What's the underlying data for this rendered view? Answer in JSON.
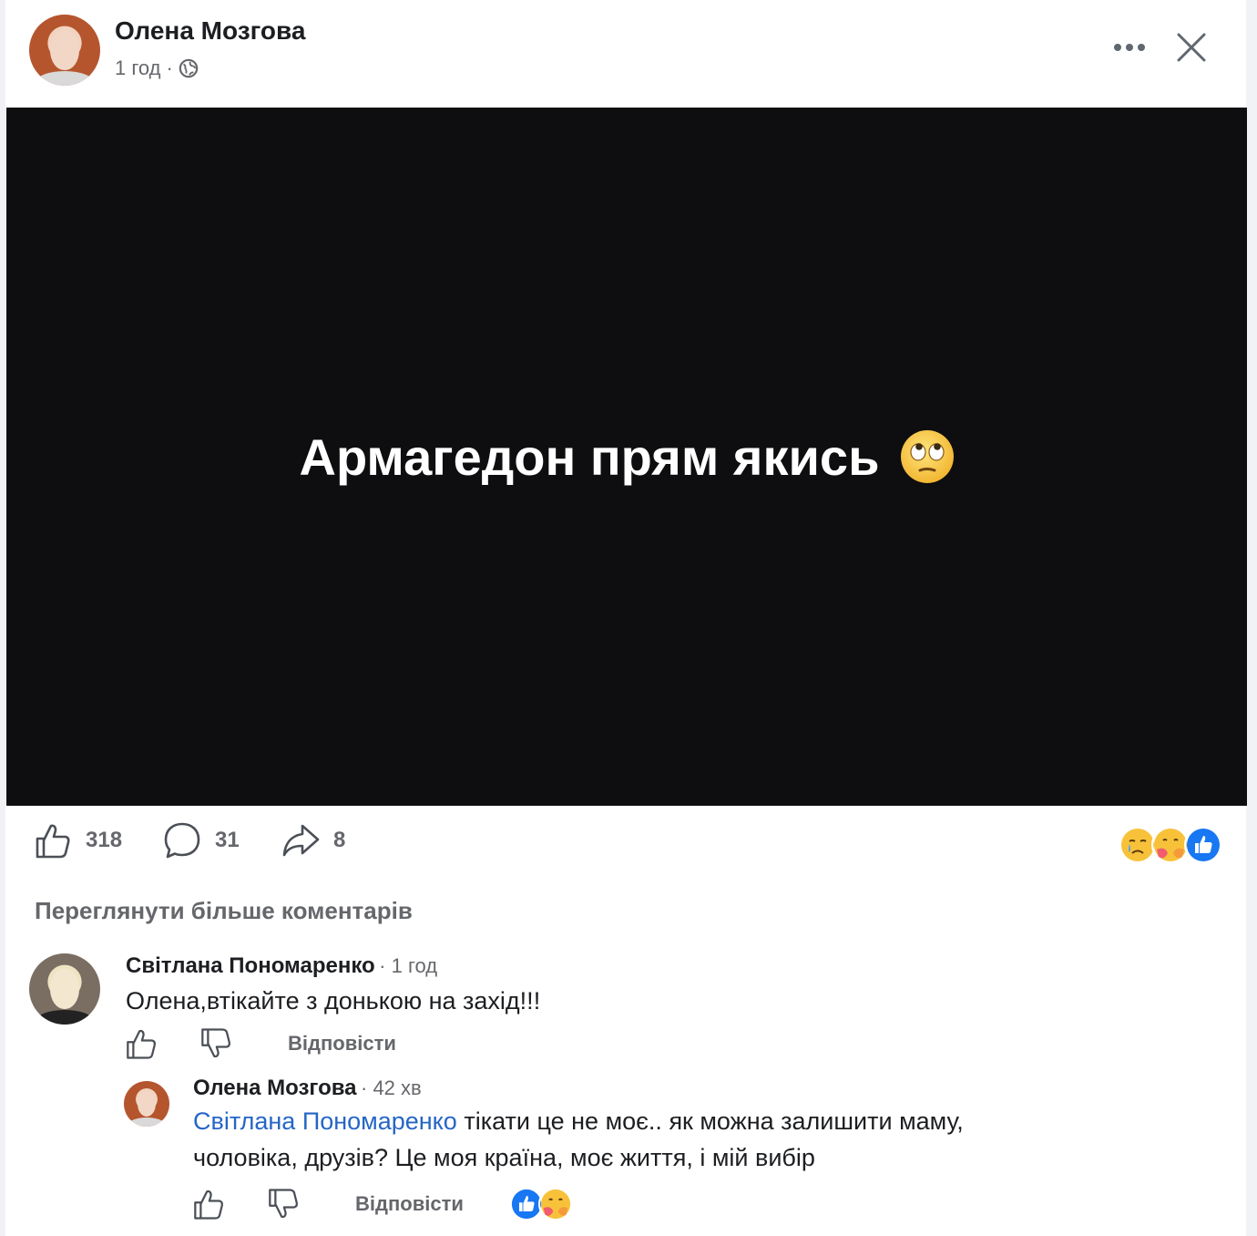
{
  "post": {
    "author": "Олена Мозгова",
    "time": "1 год",
    "text": "Армагедон прям якись",
    "emoji": "face-with-rolling-eyes-emoji",
    "stats": {
      "likes": "318",
      "comments": "31",
      "shares": "8"
    },
    "reactions": [
      "crying-face-emoji",
      "hugging-face-emoji",
      "like-reaction-icon"
    ]
  },
  "view_more_comments": "Переглянути більше коментарів",
  "comments": [
    {
      "author": "Світлана Пономаренко",
      "time": "1 год",
      "text": "Олена,втікайте з донькою на захід!!!",
      "reply_label": "Відповісти"
    }
  ],
  "reply": {
    "author": "Олена Мозгова",
    "time": "42 хв",
    "mention": "Світлана Пономаренко",
    "text_line1": " тікати це не моє.. як можна залишити маму,",
    "text_line2": "чоловіка, друзів? Це моя країна, моє життя, і мій вибір",
    "reply_label": "Відповісти",
    "reactions": [
      "like-reaction-icon",
      "hugging-face-emoji"
    ]
  }
}
